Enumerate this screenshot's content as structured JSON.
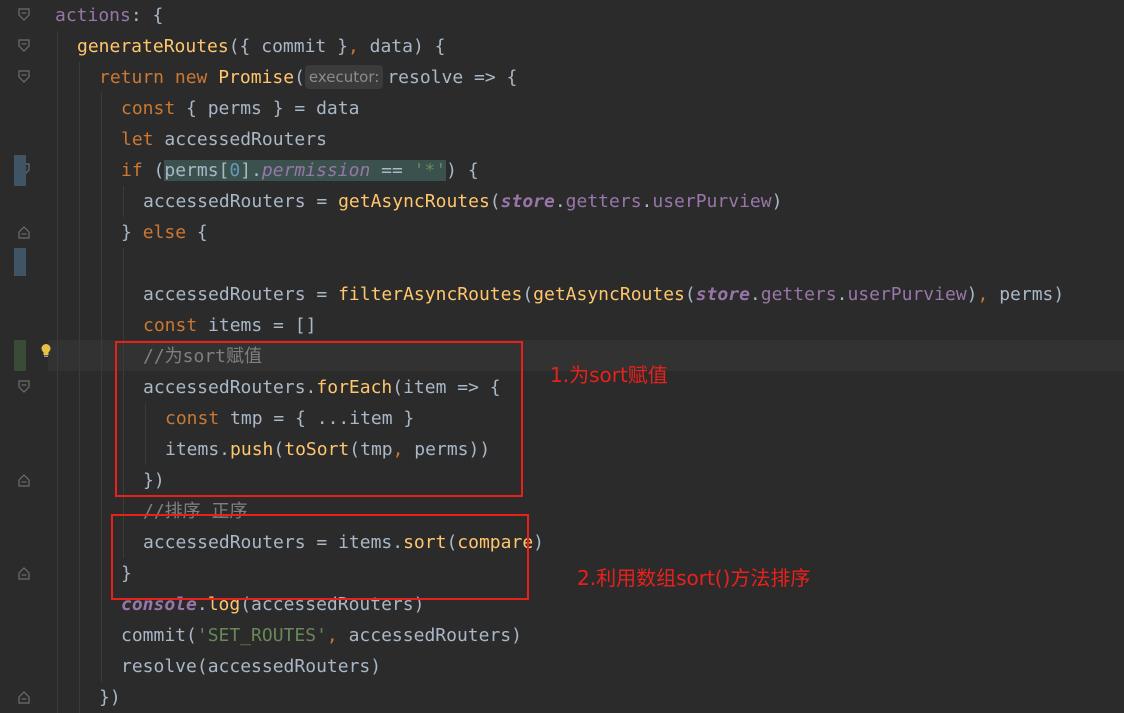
{
  "editor": {
    "lines": [
      {
        "indent": 0,
        "tokens": [
          {
            "t": "actions",
            "c": "pr"
          },
          {
            "t": ": {",
            "c": ""
          }
        ]
      },
      {
        "indent": 1,
        "tokens": [
          {
            "t": "generateRoutes",
            "c": "fn"
          },
          {
            "t": "({ commit }",
            "c": ""
          },
          {
            "t": ",",
            "c": "kw"
          },
          {
            "t": " data) {",
            "c": ""
          }
        ]
      },
      {
        "indent": 2,
        "tokens": [
          {
            "t": "return new ",
            "c": "kw"
          },
          {
            "t": "Promise",
            "c": "fn"
          },
          {
            "t": "(",
            "c": ""
          },
          {
            "t": "executor:",
            "c": "hint"
          },
          {
            "t": "resolve => {",
            "c": ""
          }
        ]
      },
      {
        "indent": 3,
        "tokens": [
          {
            "t": "const ",
            "c": "kw"
          },
          {
            "t": "{ perms } = data",
            "c": ""
          }
        ]
      },
      {
        "indent": 3,
        "tokens": [
          {
            "t": "let ",
            "c": "kw"
          },
          {
            "t": "accessedRouters",
            "c": ""
          }
        ]
      },
      {
        "indent": 3,
        "tokens": [
          {
            "t": "if ",
            "c": "kw"
          },
          {
            "t": "(",
            "c": ""
          },
          {
            "t": "perms[",
            "c": "hl"
          },
          {
            "t": "0",
            "c": "nu hl"
          },
          {
            "t": "].",
            "c": "hl"
          },
          {
            "t": "permission",
            "c": "pr it hl"
          },
          {
            "t": " == ",
            "c": "hl"
          },
          {
            "t": "'*'",
            "c": "st hl"
          },
          {
            "t": ") {",
            "c": ""
          }
        ]
      },
      {
        "indent": 4,
        "tokens": [
          {
            "t": "accessedRouters = ",
            "c": ""
          },
          {
            "t": "getAsyncRoutes",
            "c": "fn"
          },
          {
            "t": "(",
            "c": ""
          },
          {
            "t": "store",
            "c": "pr it bo"
          },
          {
            "t": ".",
            "c": ""
          },
          {
            "t": "getters",
            "c": "pr"
          },
          {
            "t": ".",
            "c": ""
          },
          {
            "t": "userPurview",
            "c": "pr"
          },
          {
            "t": ")",
            "c": ""
          }
        ]
      },
      {
        "indent": 3,
        "tokens": [
          {
            "t": "} ",
            "c": ""
          },
          {
            "t": "else ",
            "c": "kw"
          },
          {
            "t": "{",
            "c": ""
          }
        ]
      },
      {
        "indent": 0,
        "tokens": []
      },
      {
        "indent": 4,
        "tokens": [
          {
            "t": "accessedRouters = ",
            "c": ""
          },
          {
            "t": "filterAsyncRoutes",
            "c": "fn"
          },
          {
            "t": "(",
            "c": ""
          },
          {
            "t": "getAsyncRoutes",
            "c": "fn"
          },
          {
            "t": "(",
            "c": ""
          },
          {
            "t": "store",
            "c": "pr it bo"
          },
          {
            "t": ".",
            "c": ""
          },
          {
            "t": "getters",
            "c": "pr"
          },
          {
            "t": ".",
            "c": ""
          },
          {
            "t": "userPurview",
            "c": "pr"
          },
          {
            "t": ")",
            "c": ""
          },
          {
            "t": ",",
            "c": "kw"
          },
          {
            "t": " perms)",
            "c": ""
          }
        ]
      },
      {
        "indent": 4,
        "tokens": [
          {
            "t": "const ",
            "c": "kw"
          },
          {
            "t": "items = []",
            "c": ""
          }
        ]
      },
      {
        "indent": 4,
        "tokens": [
          {
            "t": "//为sort赋值",
            "c": "cm"
          }
        ]
      },
      {
        "indent": 4,
        "tokens": [
          {
            "t": "accessedRouters.",
            "c": ""
          },
          {
            "t": "forEach",
            "c": "fn"
          },
          {
            "t": "(item => {",
            "c": ""
          }
        ]
      },
      {
        "indent": 5,
        "tokens": [
          {
            "t": "const ",
            "c": "kw"
          },
          {
            "t": "tmp = { ...item }",
            "c": ""
          }
        ]
      },
      {
        "indent": 5,
        "tokens": [
          {
            "t": "items.",
            "c": ""
          },
          {
            "t": "push",
            "c": "fn"
          },
          {
            "t": "(",
            "c": ""
          },
          {
            "t": "toSort",
            "c": "fn"
          },
          {
            "t": "(tmp",
            "c": ""
          },
          {
            "t": ",",
            "c": "kw"
          },
          {
            "t": " perms))",
            "c": ""
          }
        ]
      },
      {
        "indent": 4,
        "tokens": [
          {
            "t": "})",
            "c": ""
          }
        ]
      },
      {
        "indent": 4,
        "tokens": [
          {
            "t": "//排序 正序",
            "c": "cm"
          }
        ]
      },
      {
        "indent": 4,
        "tokens": [
          {
            "t": "accessedRouters = items.",
            "c": ""
          },
          {
            "t": "sort",
            "c": "fn"
          },
          {
            "t": "(",
            "c": ""
          },
          {
            "t": "compare",
            "c": "fn"
          },
          {
            "t": ")",
            "c": ""
          }
        ]
      },
      {
        "indent": 3,
        "tokens": [
          {
            "t": "}",
            "c": ""
          }
        ]
      },
      {
        "indent": 3,
        "tokens": [
          {
            "t": "console",
            "c": "pr it bo"
          },
          {
            "t": ".",
            "c": ""
          },
          {
            "t": "log",
            "c": "fn"
          },
          {
            "t": "(accessedRouters)",
            "c": ""
          }
        ]
      },
      {
        "indent": 3,
        "tokens": [
          {
            "t": "commit(",
            "c": ""
          },
          {
            "t": "'SET_ROUTES'",
            "c": "st"
          },
          {
            "t": ",",
            "c": "kw"
          },
          {
            "t": " accessedRouters)",
            "c": ""
          }
        ]
      },
      {
        "indent": 3,
        "tokens": [
          {
            "t": "resolve(accessedRouters)",
            "c": ""
          }
        ]
      },
      {
        "indent": 2,
        "tokens": [
          {
            "t": "})",
            "c": ""
          }
        ]
      }
    ]
  },
  "annotations": [
    {
      "label": "1.为sort赋值"
    },
    {
      "label": "2.利用数组sort()方法排序"
    }
  ],
  "colors": {
    "background": "#2b2b2b",
    "keyword": "#cc7832",
    "function": "#ffc66d",
    "property": "#9876aa",
    "string": "#6a8759",
    "number": "#6897bb",
    "comment": "#808080",
    "annotation": "#e8211c"
  },
  "icons": {
    "fold": "fold-marker-icon",
    "bulb": "intention-bulb-icon"
  }
}
